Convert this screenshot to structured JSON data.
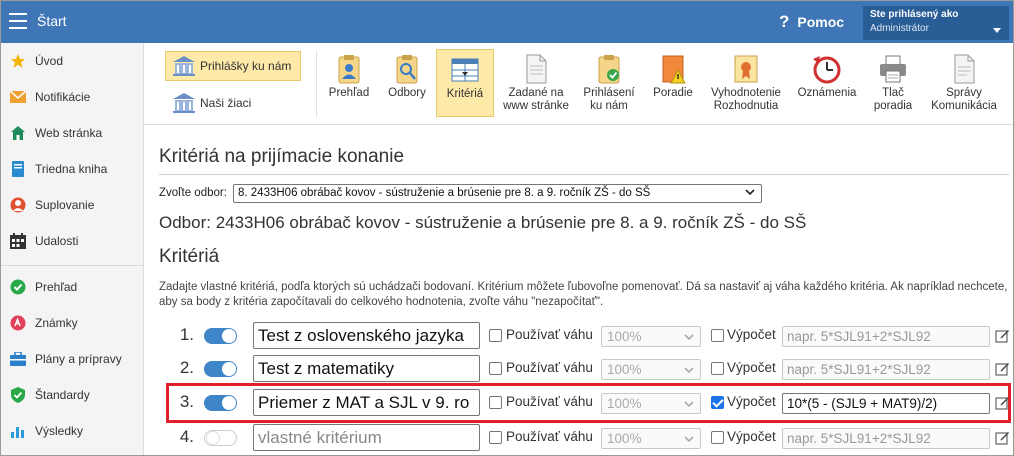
{
  "topbar": {
    "app_title": "Štart",
    "help_icon": "?",
    "help_label": "Pomoc",
    "user_status": "Ste prihlásený ako",
    "user_name": "Administrátor"
  },
  "sidebar": {
    "items": [
      {
        "label": "Úvod",
        "icon": "star-icon"
      },
      {
        "label": "Notifikácie",
        "icon": "envelope-icon"
      },
      {
        "label": "Web stránka",
        "icon": "house-icon"
      },
      {
        "label": "Triedna kniha",
        "icon": "book-icon"
      },
      {
        "label": "Suplovanie",
        "icon": "person-icon"
      },
      {
        "label": "Udalosti",
        "icon": "calendar-icon"
      },
      {
        "label": "Prehľad",
        "icon": "check-circle-icon"
      },
      {
        "label": "Známky",
        "icon": "grade-circle-icon"
      },
      {
        "label": "Plány a prípravy",
        "icon": "briefcase-icon"
      },
      {
        "label": "Štandardy",
        "icon": "shield-icon"
      },
      {
        "label": "Výsledky",
        "icon": "bar-chart-icon"
      }
    ]
  },
  "toolbar": {
    "left_buttons": [
      {
        "label": "Prihlášky ku nám",
        "active": true
      },
      {
        "label": "Naši žiaci",
        "active": false
      }
    ],
    "buttons": [
      {
        "label": "Prehľad",
        "icon": "clipboard-person-icon"
      },
      {
        "label": "Odbory",
        "icon": "clipboard-search-icon"
      },
      {
        "label": "Kritériá",
        "icon": "table-sort-icon",
        "active": true
      },
      {
        "label": "Zadané na\nwww stránke",
        "icon": "document-icon"
      },
      {
        "label": "Prihlásení\nku nám",
        "icon": "clipboard-check-icon"
      },
      {
        "label": "Poradie",
        "icon": "ranking-warning-icon"
      },
      {
        "label": "Vyhodnotenie\nRozhodnutia",
        "icon": "certificate-icon"
      },
      {
        "label": "Oznámenia",
        "icon": "clock-icon"
      },
      {
        "label": "Tlač\nporadia",
        "icon": "printer-icon"
      },
      {
        "label": "Správy\nKomunikácia",
        "icon": "message-document-icon"
      }
    ]
  },
  "main": {
    "page_title": "Kritériá na prijímacie konanie",
    "obor_label": "Zvoľte odbor:",
    "obor_selected": "8. 2433H06 obrábač kovov - sústruženie a brúsenie pre 8. a 9. ročník ZŠ - do SŠ",
    "obor_heading": "Odbor: 2433H06 obrábač kovov - sústruženie a brúsenie pre 8. a 9. ročník ZŠ - do SŠ",
    "criteria_heading": "Kritériá",
    "description": "Zadajte vlastné kritériá, podľa ktorých sú uchádzači bodovaní. Kritérium môžete ľubovoľne pomenovať. Dá sa nastaviť aj váha každého kritéria. Ak napríklad nechcete, aby sa body z kritéria započítavali do celkového hodnotenia, zvoľte váhu \"nezapočítať\".",
    "weight_label": "Používať váhu",
    "calc_label": "Výpočet",
    "criteria": [
      {
        "number": "1.",
        "enabled": true,
        "name": "Test z oslovenského jazyka",
        "placeholder": "",
        "use_weight": false,
        "weight": "100%",
        "use_calc": false,
        "calc": "",
        "calc_placeholder": "napr. 5*SJL91+2*SJL92"
      },
      {
        "number": "2.",
        "enabled": true,
        "name": "Test z matematiky",
        "placeholder": "",
        "use_weight": false,
        "weight": "100%",
        "use_calc": false,
        "calc": "",
        "calc_placeholder": "napr. 5*SJL91+2*SJL92"
      },
      {
        "number": "3.",
        "enabled": true,
        "name": "Priemer z MAT a SJL v 9. ro",
        "placeholder": "",
        "use_weight": false,
        "weight": "100%",
        "use_calc": true,
        "calc": "10*(5 - (SJL9 + MAT9)/2)",
        "calc_placeholder": ""
      },
      {
        "number": "4.",
        "enabled": false,
        "name": "",
        "placeholder": "vlastné kritérium",
        "use_weight": false,
        "weight": "100%",
        "use_calc": false,
        "calc": "",
        "calc_placeholder": "napr. 5*SJL91+2*SJL92"
      }
    ]
  },
  "colors": {
    "topbar": "#3f76b5",
    "accent_active": "#fde9a8",
    "toggle_on": "#3f86c8",
    "highlight": "#e0202a"
  }
}
